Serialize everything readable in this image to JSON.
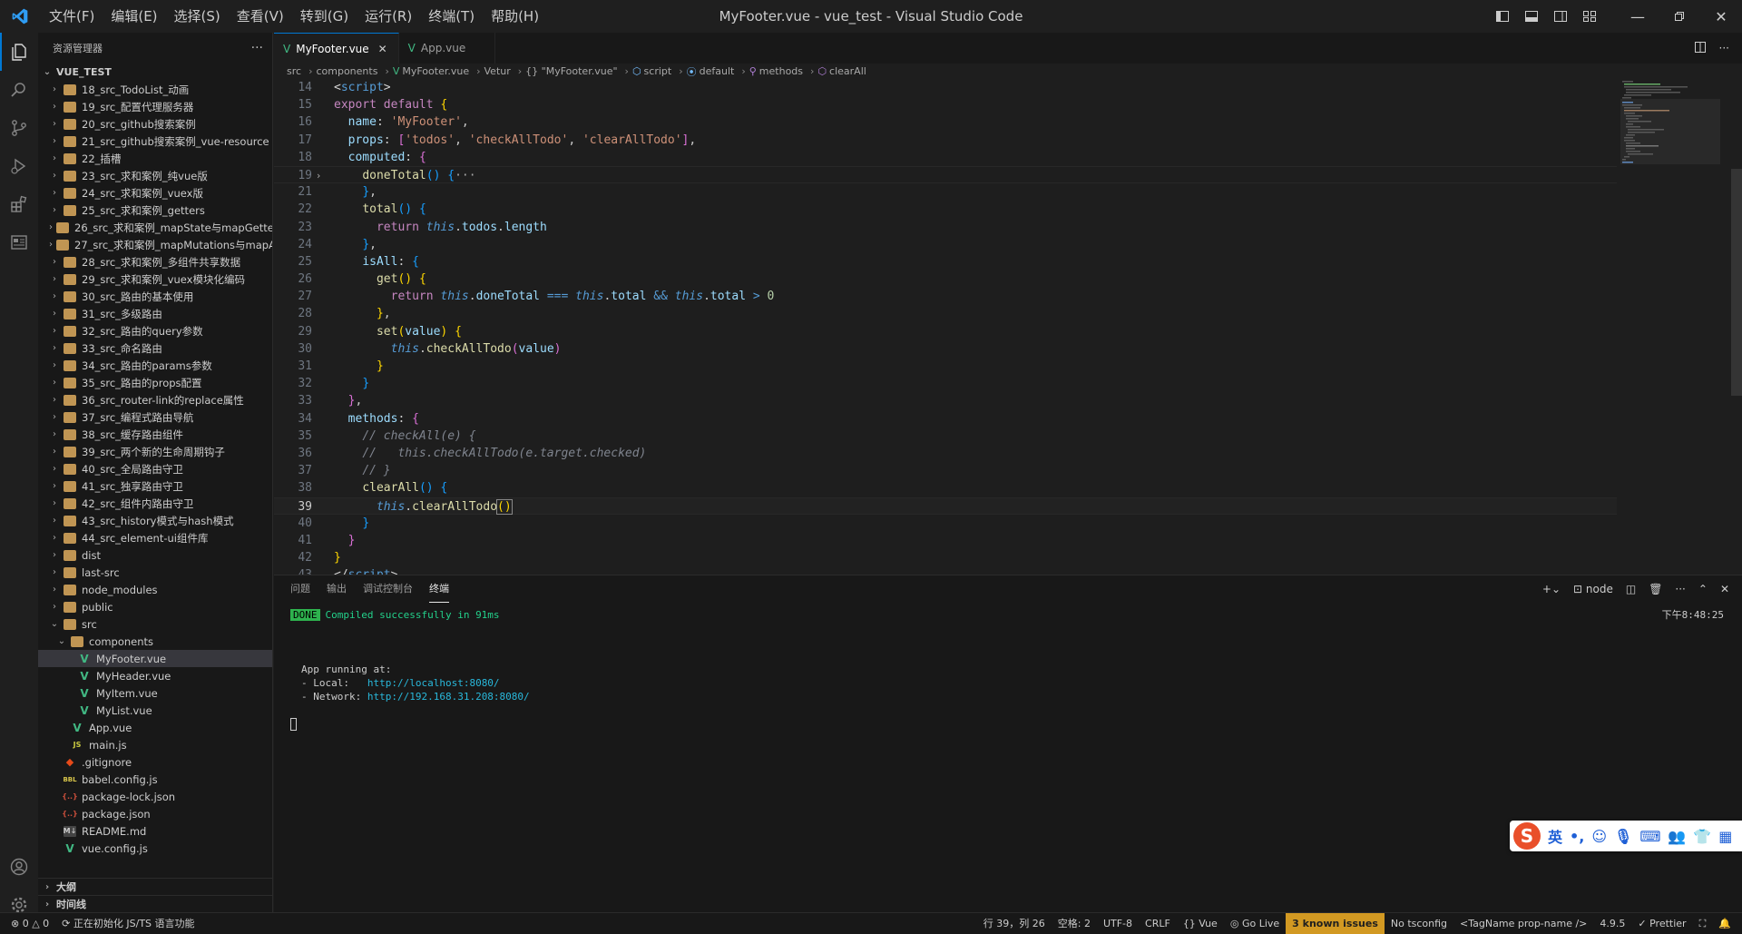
{
  "window": {
    "title": "MyFooter.vue - vue_test - Visual Studio Code",
    "menus": [
      "文件(F)",
      "编辑(E)",
      "选择(S)",
      "查看(V)",
      "转到(G)",
      "运行(R)",
      "终端(T)",
      "帮助(H)"
    ]
  },
  "sidebar": {
    "title": "资源管理器",
    "more": "···",
    "root": "VUE_TEST",
    "items": [
      {
        "label": "18_src_TodoList_动画",
        "type": "folder",
        "depth": 1
      },
      {
        "label": "19_src_配置代理服务器",
        "type": "folder",
        "depth": 1
      },
      {
        "label": "20_src_github搜索案例",
        "type": "folder",
        "depth": 1
      },
      {
        "label": "21_src_github搜索案例_vue-resource",
        "type": "folder",
        "depth": 1
      },
      {
        "label": "22_插槽",
        "type": "folder",
        "depth": 1
      },
      {
        "label": "23_src_求和案例_纯vue版",
        "type": "folder",
        "depth": 1
      },
      {
        "label": "24_src_求和案例_vuex版",
        "type": "folder",
        "depth": 1
      },
      {
        "label": "25_src_求和案例_getters",
        "type": "folder",
        "depth": 1
      },
      {
        "label": "26_src_求和案例_mapState与mapGetters",
        "type": "folder",
        "depth": 1
      },
      {
        "label": "27_src_求和案例_mapMutations与mapA...",
        "type": "folder",
        "depth": 1
      },
      {
        "label": "28_src_求和案例_多组件共享数据",
        "type": "folder",
        "depth": 1
      },
      {
        "label": "29_src_求和案例_vuex模块化编码",
        "type": "folder",
        "depth": 1
      },
      {
        "label": "30_src_路由的基本使用",
        "type": "folder",
        "depth": 1
      },
      {
        "label": "31_src_多级路由",
        "type": "folder",
        "depth": 1
      },
      {
        "label": "32_src_路由的query参数",
        "type": "folder",
        "depth": 1
      },
      {
        "label": "33_src_命名路由",
        "type": "folder",
        "depth": 1
      },
      {
        "label": "34_src_路由的params参数",
        "type": "folder",
        "depth": 1
      },
      {
        "label": "35_src_路由的props配置",
        "type": "folder",
        "depth": 1
      },
      {
        "label": "36_src_router-link的replace属性",
        "type": "folder",
        "depth": 1
      },
      {
        "label": "37_src_编程式路由导航",
        "type": "folder",
        "depth": 1
      },
      {
        "label": "38_src_缓存路由组件",
        "type": "folder",
        "depth": 1
      },
      {
        "label": "39_src_两个新的生命周期钩子",
        "type": "folder",
        "depth": 1
      },
      {
        "label": "40_src_全局路由守卫",
        "type": "folder",
        "depth": 1
      },
      {
        "label": "41_src_独享路由守卫",
        "type": "folder",
        "depth": 1
      },
      {
        "label": "42_src_组件内路由守卫",
        "type": "folder",
        "depth": 1
      },
      {
        "label": "43_src_history模式与hash模式",
        "type": "folder",
        "depth": 1
      },
      {
        "label": "44_src_element-ui组件库",
        "type": "folder",
        "depth": 1
      },
      {
        "label": "dist",
        "type": "folder",
        "depth": 1
      },
      {
        "label": "last-src",
        "type": "folder",
        "depth": 1
      },
      {
        "label": "node_modules",
        "type": "folder",
        "depth": 1
      },
      {
        "label": "public",
        "type": "folder",
        "depth": 1
      },
      {
        "label": "src",
        "type": "folder-open",
        "depth": 1
      },
      {
        "label": "components",
        "type": "folder-open",
        "depth": 2
      },
      {
        "label": "MyFooter.vue",
        "type": "vue",
        "depth": 3,
        "selected": true
      },
      {
        "label": "MyHeader.vue",
        "type": "vue",
        "depth": 3
      },
      {
        "label": "MyItem.vue",
        "type": "vue",
        "depth": 3
      },
      {
        "label": "MyList.vue",
        "type": "vue",
        "depth": 3
      },
      {
        "label": "App.vue",
        "type": "vue",
        "depth": 2
      },
      {
        "label": "main.js",
        "type": "js",
        "depth": 2
      },
      {
        "label": ".gitignore",
        "type": "git",
        "depth": 1
      },
      {
        "label": "babel.config.js",
        "type": "babel",
        "depth": 1
      },
      {
        "label": "package-lock.json",
        "type": "json",
        "depth": 1
      },
      {
        "label": "package.json",
        "type": "json",
        "depth": 1
      },
      {
        "label": "README.md",
        "type": "md",
        "depth": 1
      },
      {
        "label": "vue.config.js",
        "type": "vue",
        "depth": 1
      }
    ],
    "outline": "大纲",
    "timeline": "时间线"
  },
  "tabs": [
    {
      "label": "MyFooter.vue",
      "active": true
    },
    {
      "label": "App.vue",
      "active": false
    }
  ],
  "breadcrumbs": [
    "src",
    "components",
    "MyFooter.vue",
    "Vetur",
    "{} \"MyFooter.vue\"",
    "script",
    "default",
    "methods",
    "clearAll"
  ],
  "panel": {
    "tabs": [
      "问题",
      "输出",
      "调试控制台",
      "终端"
    ],
    "active_tab": "终端",
    "shell": "node",
    "terminal": {
      "done": "DONE",
      "compiled": "Compiled successfully in 91ms",
      "time": "下午8:48:25",
      "running": "App running at:",
      "local_label": "- Local:   ",
      "local_url": "http://localhost:8080/",
      "network_label": "- Network: ",
      "network_url": "http://192.168.31.208:8080/"
    }
  },
  "ime": {
    "lang": "英",
    "punct": "•,"
  },
  "status": {
    "errors": "⊗ 0 △ 0",
    "init": "正在初始化 JS/TS 语言功能",
    "position": "行 39，列 26",
    "spaces": "空格: 2",
    "encoding": "UTF-8",
    "eol": "CRLF",
    "lang": "{} Vue",
    "golive": "Go Live",
    "issues": "3 known issues",
    "tsconfig": "No tsconfig",
    "tag": "<TagName prop-name />",
    "version": "4.9.5",
    "prettier": "✓ Prettier"
  },
  "colors": {
    "accent": "#0078d4",
    "warning": "#d29922",
    "vue_green": "#41b883"
  }
}
